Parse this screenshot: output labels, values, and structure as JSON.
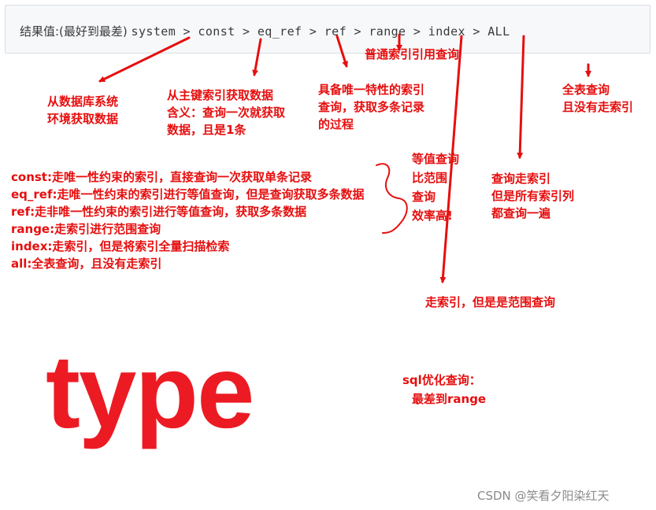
{
  "code": {
    "prefix": "结果值:(最好到最差)",
    "chain": "system > const > eq_ref > ref > range > index > ALL"
  },
  "notes": {
    "ref_label": "普通索引引用查询",
    "system": [
      "从数据库系统",
      "环境获取数据"
    ],
    "const": [
      "从主键索引获取数据",
      "含义：查询一次就获取",
      "数据，且是1条"
    ],
    "eq_ref": [
      "具备唯一特性的索引",
      "查询，获取多条记录",
      "的过程"
    ],
    "all": [
      "全表查询",
      "且没有走索引"
    ],
    "index": [
      "查询走索引",
      "但是所有索引列",
      "都查询一遍"
    ],
    "range": "走索引，但是是范围查询",
    "efficiency": [
      "等值查询",
      "比范围",
      "查询",
      "效率高!"
    ],
    "optimize": [
      "sql优化查询：",
      "最差到range"
    ]
  },
  "legend": [
    "const:走唯一性约束的索引，直接查询一次获取单条记录",
    "eq_ref:走唯一性约束的索引进行等值查询，但是查询获取多条数据",
    "ref:走非唯一性约束的索引进行等值查询，获取多条数据",
    "range:走索引进行范围查询",
    "index:走索引，但是将索引全量扫描检索",
    "all:全表查询，且没有走索引"
  ],
  "title": "type",
  "watermark": "CSDN @笑看夕阳染红天",
  "colors": {
    "annotation": "#e60e0e",
    "title": "#ec1b23",
    "code_bg": "#f6f8fa"
  }
}
